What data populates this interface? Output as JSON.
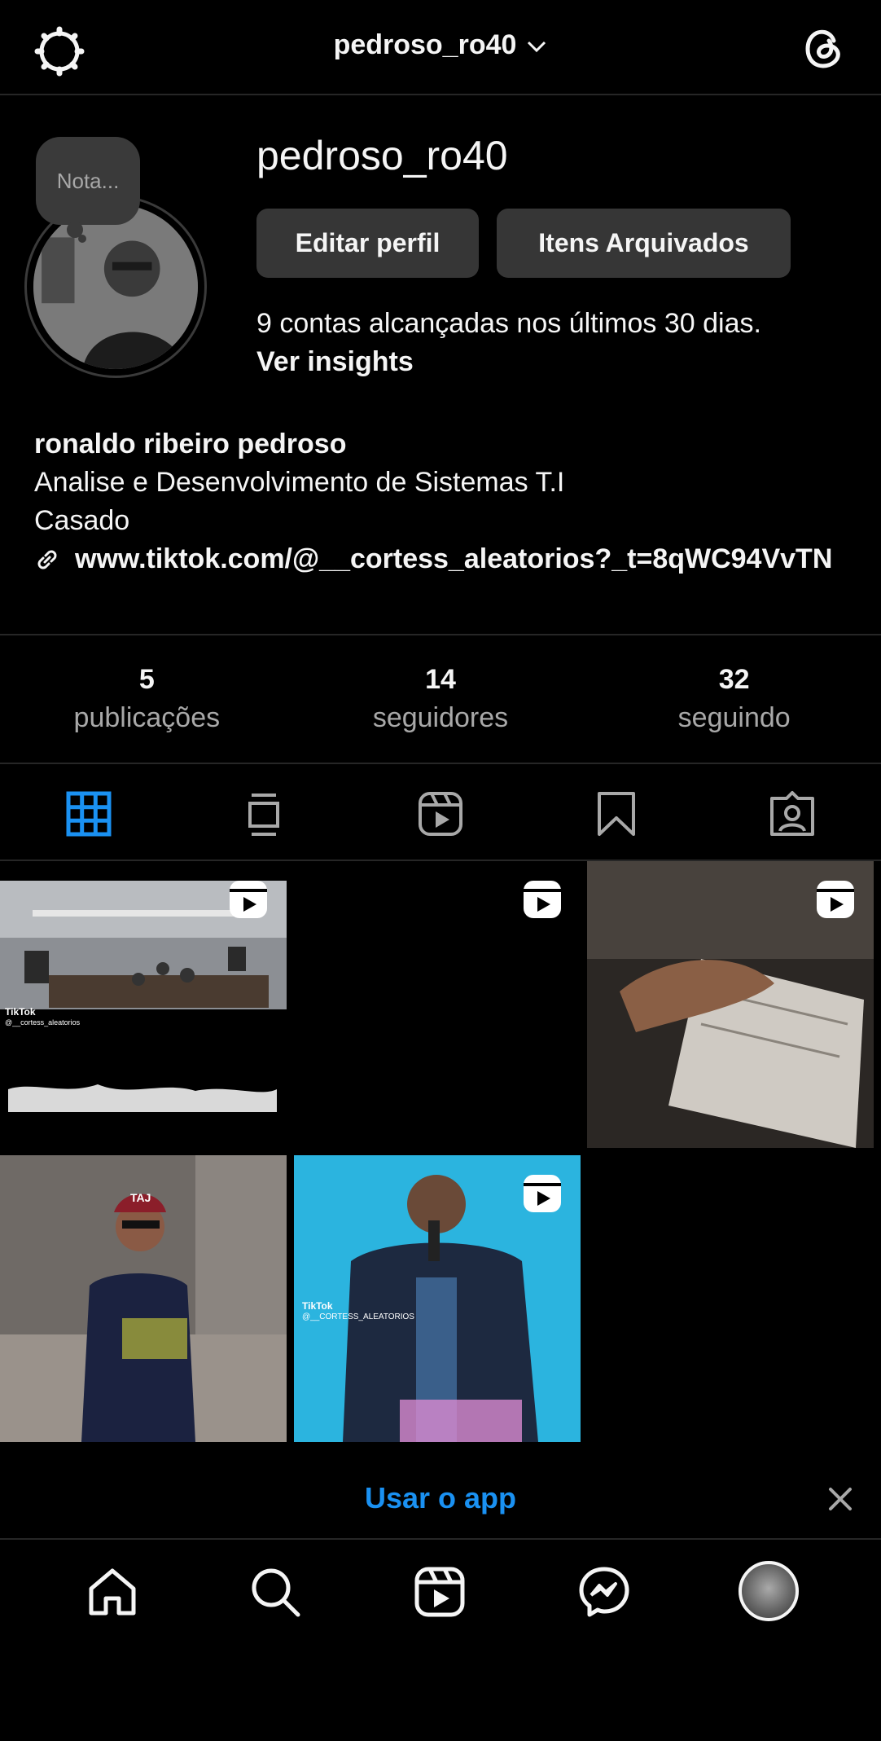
{
  "header": {
    "username": "pedroso_ro40"
  },
  "profile": {
    "note_placeholder": "Nota...",
    "username": "pedroso_ro40",
    "edit_button": "Editar perfil",
    "archive_button": "Itens Arquivados",
    "reach_text": "9 contas alcançadas nos últimos 30 dias.",
    "insights_link": "Ver insights",
    "full_name": "ronaldo ribeiro pedroso",
    "bio_lines": [
      "Analise e Desenvolvimento de Sistemas T.I",
      "Casado"
    ],
    "website": "www.tiktok.com/@__cortess_aleatorios?_t=8qWC94VvTN"
  },
  "stats": [
    {
      "value": "5",
      "label": "publicações"
    },
    {
      "value": "14",
      "label": "seguidores"
    },
    {
      "value": "32",
      "label": "seguindo"
    }
  ],
  "tabs": [
    {
      "icon": "grid-icon",
      "active": true
    },
    {
      "icon": "feed-icon",
      "active": false
    },
    {
      "icon": "reels-icon",
      "active": false
    },
    {
      "icon": "saved-icon",
      "active": false
    },
    {
      "icon": "tagged-icon",
      "active": false
    }
  ],
  "posts": [
    {
      "type": "reel",
      "overlay_text": [
        "TikTok",
        "@__cortess_aleatorios"
      ]
    },
    {
      "type": "reel",
      "overlay_text": []
    },
    {
      "type": "reel",
      "overlay_text": []
    },
    {
      "type": "photo",
      "overlay_text": [
        "TAJ"
      ]
    },
    {
      "type": "reel",
      "overlay_text": [
        "TikTok",
        "@__CORTESS_ALEATORIOS"
      ]
    }
  ],
  "app_banner": {
    "label": "Usar o app"
  },
  "bottom_nav": [
    "home-icon",
    "search-icon",
    "reels-icon",
    "messenger-icon",
    "profile-avatar"
  ],
  "colors": {
    "background": "#000000",
    "accent": "#1a91f2",
    "button": "#363636",
    "secondary_text": "#a8a8a8"
  }
}
